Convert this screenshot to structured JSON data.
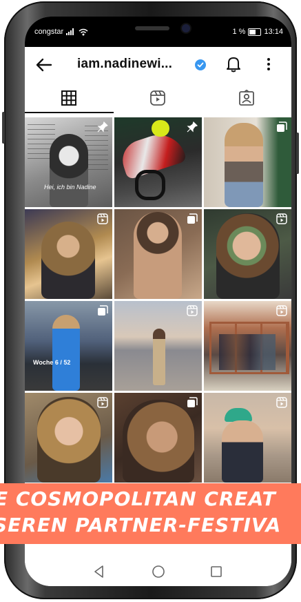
{
  "status_bar": {
    "carrier": "congstar",
    "battery": "1 %",
    "time": "13:14"
  },
  "header": {
    "username": "iam.nadinewi...",
    "verified": true,
    "back_icon": "back-arrow-icon",
    "bell_icon": "notification-bell-icon",
    "more_icon": "more-vertical-icon"
  },
  "tabs": [
    {
      "name": "posts-grid",
      "icon": "grid-icon",
      "selected": true
    },
    {
      "name": "reels",
      "icon": "reels-icon",
      "selected": false
    },
    {
      "name": "tagged",
      "icon": "tagged-person-icon",
      "selected": false
    }
  ],
  "grid": {
    "tiles": [
      {
        "badge": "pin-icon",
        "caption": "Hei, ich bin Nadine"
      },
      {
        "badge": "pin-icon",
        "caption": ""
      },
      {
        "badge": "carousel-icon",
        "caption": ""
      },
      {
        "badge": "reels-icon",
        "caption": ""
      },
      {
        "badge": "carousel-icon",
        "caption": ""
      },
      {
        "badge": "reels-icon",
        "caption": ""
      },
      {
        "badge": "carousel-icon",
        "caption": "Woche 6 / 52"
      },
      {
        "badge": "reels-icon",
        "caption": ""
      },
      {
        "badge": "reels-icon",
        "caption": ""
      },
      {
        "badge": "reels-icon",
        "caption": ""
      },
      {
        "badge": "carousel-icon",
        "caption": ""
      },
      {
        "badge": "reels-icon",
        "caption": ""
      }
    ]
  },
  "banner": {
    "line1": "E COSMOPOLITAN CREAT",
    "line2": "SEREN PARTNER-FESTIVA",
    "color": "#ff7a5c"
  },
  "nav_bar": {
    "back_icon": "nav-back-triangle-icon",
    "home_icon": "nav-home-circle-icon",
    "recents_icon": "nav-recents-square-icon"
  }
}
